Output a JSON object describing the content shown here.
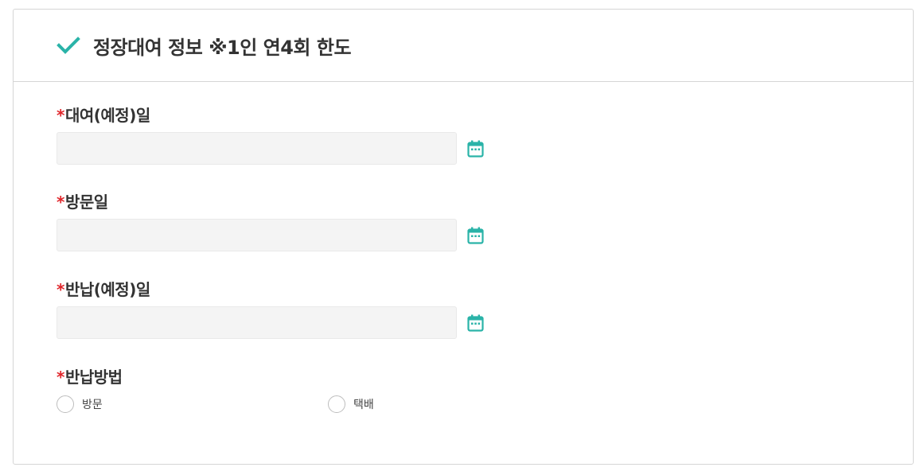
{
  "section": {
    "title": "정장대여 정보 ※1인 연4회 한도",
    "accent_color": "#2ab3a8",
    "required_marker_color": "#e0262b",
    "header_icon": "check-icon"
  },
  "fields": {
    "rental_date": {
      "required_mark": "*",
      "label": "대여(예정)일",
      "value": "",
      "icon": "calendar-icon"
    },
    "visit_date": {
      "required_mark": "*",
      "label": "방문일",
      "value": "",
      "icon": "calendar-icon"
    },
    "return_date": {
      "required_mark": "*",
      "label": "반납(예정)일",
      "value": "",
      "icon": "calendar-icon"
    },
    "return_method": {
      "required_mark": "*",
      "label": "반납방법",
      "options": [
        {
          "label": "방문",
          "selected": false
        },
        {
          "label": "택배",
          "selected": false
        }
      ]
    }
  }
}
